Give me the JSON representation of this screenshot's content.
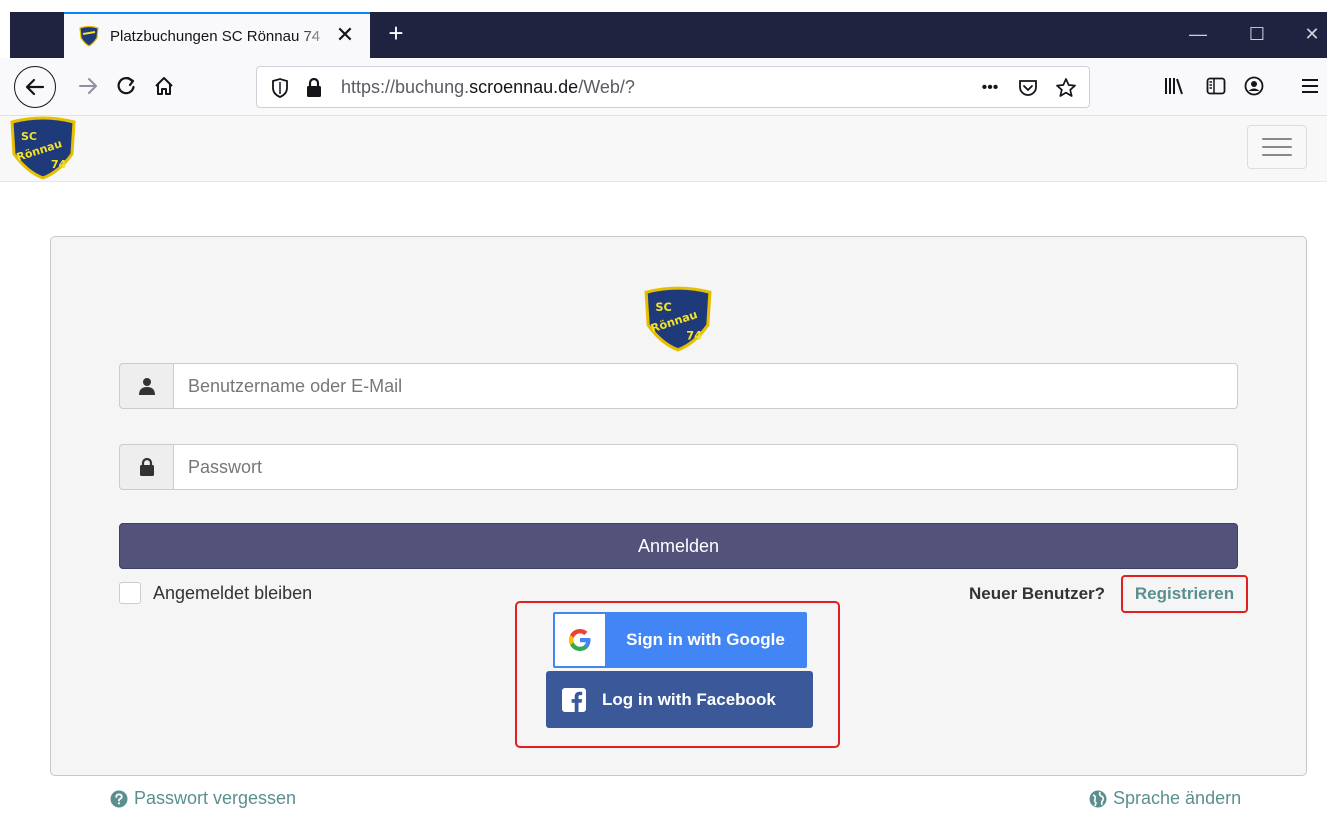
{
  "browser": {
    "tab_title": "Platzbuchungen SC Rönnau 74",
    "tab_close": "✕",
    "new_tab": "+",
    "url_prefix": "https://buchung.",
    "url_domain": "scroennau.de",
    "url_suffix": "/Web/?",
    "page_actions": "•••",
    "icons": [
      "back-icon",
      "forward-icon",
      "reload-icon",
      "home-icon",
      "tracking-shield-icon",
      "lock-icon",
      "pocket-icon",
      "bookmark-star-icon",
      "library-icon",
      "sidebar-icon",
      "account-icon",
      "menu-icon"
    ],
    "window_controls": {
      "minimize": "—",
      "maximize": "☐",
      "close": "✕"
    }
  },
  "header": {
    "logo_text_1": "SC",
    "logo_text_2": "Rönnau",
    "logo_text_3": "74",
    "logo_colors": {
      "shield": "#1f3a7a",
      "text": "#f2e22a",
      "border": "#e6c000"
    }
  },
  "login": {
    "username_placeholder": "Benutzername oder E-Mail",
    "password_placeholder": "Passwort",
    "submit_label": "Anmelden",
    "remember_label": "Angemeldet bleiben",
    "new_user_text": "Neuer Benutzer?",
    "register_label": "Registrieren"
  },
  "social": {
    "google_label": "Sign in with Google",
    "facebook_label": "Log in with Facebook"
  },
  "footer": {
    "forgot_password": "Passwort vergessen",
    "change_language": "Sprache ändern"
  },
  "colors": {
    "submit_bg": "#52527b",
    "link": "#5b8f8f",
    "highlight": "#e02020",
    "google_blue": "#4285f4",
    "facebook_blue": "#3b5998"
  }
}
